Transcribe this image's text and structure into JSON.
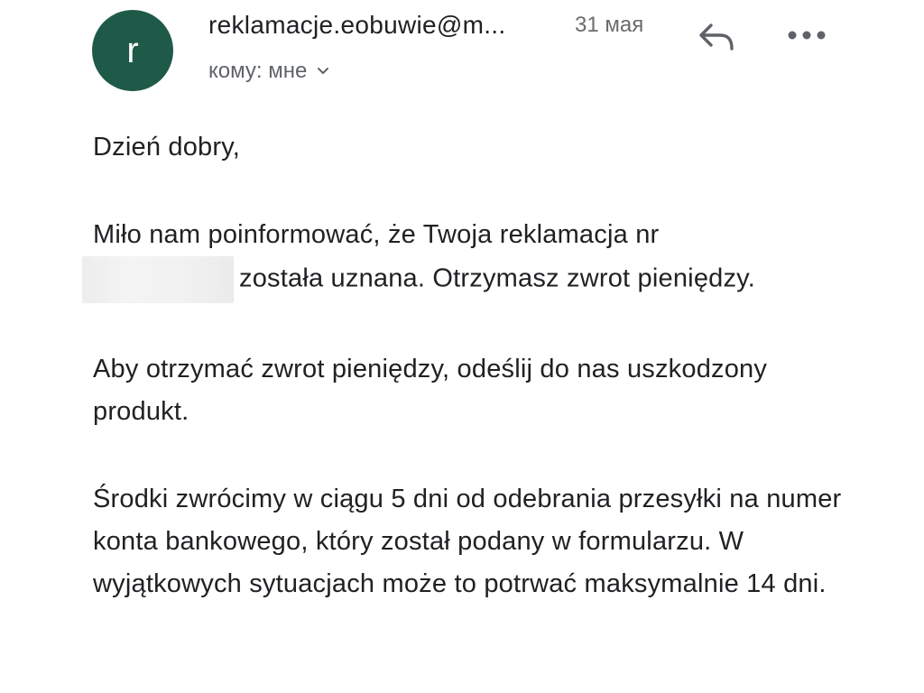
{
  "colors": {
    "avatar_bg": "#1f5a48",
    "icon": "#5f6368"
  },
  "message": {
    "avatar_letter": "r",
    "sender": "reklamacje.eobuwie@m...",
    "date": "31 мая",
    "recipient": "кому: мне",
    "icons": {
      "reply": "reply-arrow-icon",
      "more": "more-horizontal-icon",
      "expand": "chevron-down-icon"
    }
  },
  "body": {
    "greeting": "Dzień dobry,",
    "p1_part1": "Miło nam poinformować, że Twoja reklamacja nr",
    "p1_part2": "została uznana. Otrzymasz zwrot pieniędzy.",
    "p2": "Aby otrzymać zwrot pieniędzy, odeślij do nas uszkodzony produkt.",
    "p3": "Środki zwrócimy w ciągu 5 dni od odebrania przesyłki na numer konta bankowego, który został podany w formularzu. W wyjątkowych sytuacjach może to potrwać maksymalnie 14 dni."
  }
}
